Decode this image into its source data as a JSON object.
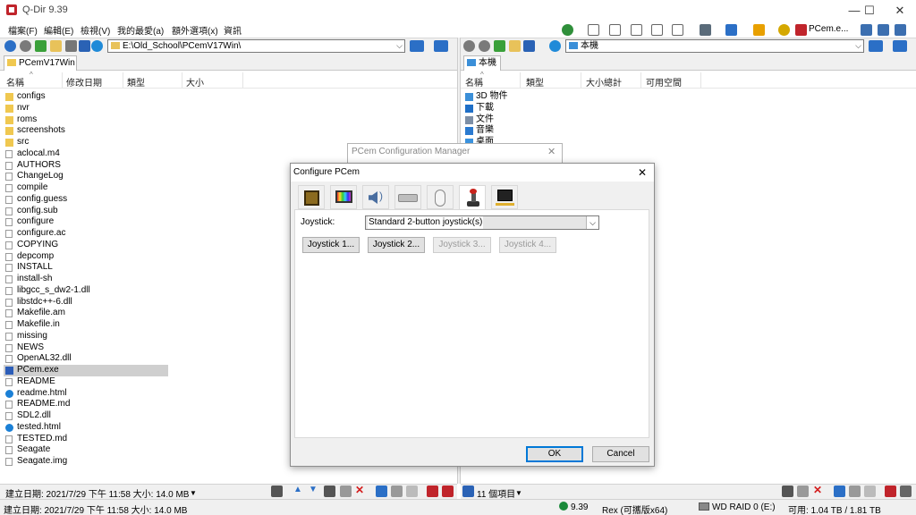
{
  "window": {
    "title": "Q-Dir 9.39",
    "controls": [
      "—",
      "☐",
      "✕"
    ]
  },
  "menu": [
    "檔案(F)",
    "編輯(E)",
    "檢視(V)",
    "我的最愛(a)",
    "額外選項(x)",
    "資訊"
  ],
  "toolbar_right": {
    "label": "PCem.e..."
  },
  "left_pane": {
    "address": "E:\\Old_School\\PCemV17Win\\",
    "tab": "PCemV17Win",
    "columns": [
      "名稱",
      "修改日期",
      "類型",
      "大小"
    ],
    "files": [
      {
        "name": "configs",
        "type": "folder"
      },
      {
        "name": "nvr",
        "type": "folder"
      },
      {
        "name": "roms",
        "type": "folder"
      },
      {
        "name": "screenshots",
        "type": "folder"
      },
      {
        "name": "src",
        "type": "folder"
      },
      {
        "name": "aclocal.m4",
        "type": "file"
      },
      {
        "name": "AUTHORS",
        "type": "file"
      },
      {
        "name": "ChangeLog",
        "type": "file"
      },
      {
        "name": "compile",
        "type": "file"
      },
      {
        "name": "config.guess",
        "type": "file"
      },
      {
        "name": "config.sub",
        "type": "file"
      },
      {
        "name": "configure",
        "type": "file"
      },
      {
        "name": "configure.ac",
        "type": "file"
      },
      {
        "name": "COPYING",
        "type": "file"
      },
      {
        "name": "depcomp",
        "type": "file"
      },
      {
        "name": "INSTALL",
        "type": "file"
      },
      {
        "name": "install-sh",
        "type": "file"
      },
      {
        "name": "libgcc_s_dw2-1.dll",
        "type": "dll"
      },
      {
        "name": "libstdc++-6.dll",
        "type": "dll"
      },
      {
        "name": "Makefile.am",
        "type": "file"
      },
      {
        "name": "Makefile.in",
        "type": "file"
      },
      {
        "name": "missing",
        "type": "file"
      },
      {
        "name": "NEWS",
        "type": "file"
      },
      {
        "name": "OpenAL32.dll",
        "type": "dll"
      },
      {
        "name": "PCem.exe",
        "type": "exe",
        "selected": true
      },
      {
        "name": "README",
        "type": "file"
      },
      {
        "name": "readme.html",
        "type": "edge"
      },
      {
        "name": "README.md",
        "type": "file"
      },
      {
        "name": "SDL2.dll",
        "type": "dll"
      },
      {
        "name": "tested.html",
        "type": "edge"
      },
      {
        "name": "TESTED.md",
        "type": "file"
      },
      {
        "name": "Seagate",
        "type": "file"
      },
      {
        "name": "Seagate.img",
        "type": "file"
      }
    ],
    "status": "建立日期: 2021/7/29 下午 11:58 大小: 14.0 MB"
  },
  "right_pane": {
    "address": "本機",
    "tab": "本機",
    "columns": [
      "名稱",
      "類型",
      "大小總計",
      "可用空間"
    ],
    "items": [
      {
        "name": "3D 物件",
        "color": "#3b8fd8"
      },
      {
        "name": "下載",
        "color": "#1f6fc7"
      },
      {
        "name": "文件",
        "color": "#7d8fa6"
      },
      {
        "name": "音樂",
        "color": "#2a7ad0"
      },
      {
        "name": "桌面",
        "color": "#3a92de"
      }
    ],
    "status": "11 個項目"
  },
  "bottom": {
    "left": "建立日期: 2021/7/29 下午 11:58 大小: 14.0 MB",
    "version": "9.39",
    "edition": "Rex (可攜版x64)",
    "drive": "WD RAID 0 (E:)",
    "space": "可用: 1.04 TB / 1.81 TB"
  },
  "back_dialog": {
    "title": "PCem Configuration Manager"
  },
  "dialog": {
    "title": "Configure PCem",
    "close": "✕",
    "joystick_label": "Joystick:",
    "joystick_value": "Standard 2-button joystick(s)",
    "buttons": [
      "Joystick 1...",
      "Joystick 2...",
      "Joystick 3...",
      "Joystick 4..."
    ],
    "ok": "OK",
    "cancel": "Cancel"
  },
  "colors": {
    "accent": "#0078d7",
    "folder": "#f0c850",
    "status_bg": "#f0f0f0"
  }
}
